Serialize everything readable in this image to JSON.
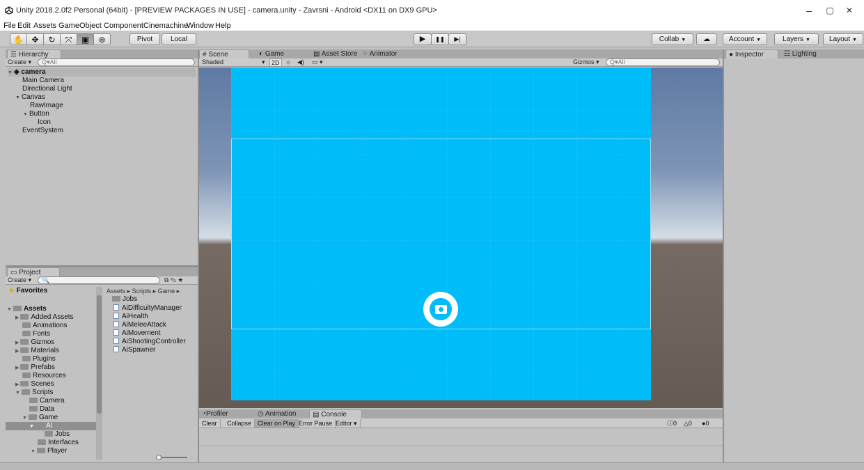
{
  "window": {
    "title": "Unity 2018.2.0f2 Personal (64bit) - [PREVIEW PACKAGES IN USE] - camera.unity - Zavrsni - Android <DX11 on DX9 GPU>",
    "minimize": "–",
    "maximize": "▢",
    "close": "✕"
  },
  "menu": [
    "File",
    "Edit",
    "Assets",
    "GameObject",
    "Component",
    "Cinemachine",
    "Window",
    "Help"
  ],
  "toolbar": {
    "tools": [
      "hand-icon",
      "move-icon",
      "rotate-icon",
      "scale-icon",
      "rect-icon",
      "transform-icon"
    ],
    "pivot": "Pivot",
    "local": "Local",
    "play": "▶",
    "pause": "❚❚",
    "step": "▶|",
    "collab": "Collab",
    "account": "Account",
    "layers": "Layers",
    "layout": "Layout"
  },
  "hierarchy": {
    "tab": "Hierarchy",
    "create": "Create",
    "search_placeholder": "Q▾All",
    "scene": "camera",
    "items": [
      "Main Camera",
      "Directional Light",
      "Canvas",
      "RawImage",
      "Button",
      "Icon",
      "EventSystem"
    ]
  },
  "scene_tabs": {
    "scene": "Scene",
    "game": "Game",
    "asset_store": "Asset Store",
    "animator": "Animator",
    "shaded": "Shaded",
    "mode_2d": "2D",
    "gizmos": "Gizmos",
    "search_placeholder": "Q▾All"
  },
  "inspector": {
    "tab": "Inspector",
    "lighting": "Lighting"
  },
  "project": {
    "tab": "Project",
    "create": "Create",
    "favorites": "Favorites",
    "assets": "Assets",
    "tree": [
      "Added Assets",
      "Animations",
      "Fonts",
      "Gizmos",
      "Materials",
      "Plugins",
      "Prefabs",
      "Resources",
      "Scenes",
      "Scripts",
      "Camera",
      "Data",
      "Game",
      "AI",
      "Jobs",
      "Interfaces",
      "Player"
    ],
    "breadcrumb": [
      "Assets",
      "Scripts",
      "Game"
    ],
    "files": [
      "Jobs",
      "AiDifficultyManager",
      "AiHealth",
      "AiMeleeAttack",
      "AiMovement",
      "AiShootingController",
      "AiSpawner"
    ]
  },
  "console": {
    "tabs": [
      "Profiler",
      "Animation",
      "Console"
    ],
    "buttons": [
      "Clear",
      "Collapse",
      "Clear on Play",
      "Error Pause",
      "Editor"
    ],
    "info_count": "0",
    "warn_count": "0",
    "error_count": "0"
  },
  "colors": {
    "canvas": "#00bcf8",
    "panel": "#c2c2c2"
  }
}
